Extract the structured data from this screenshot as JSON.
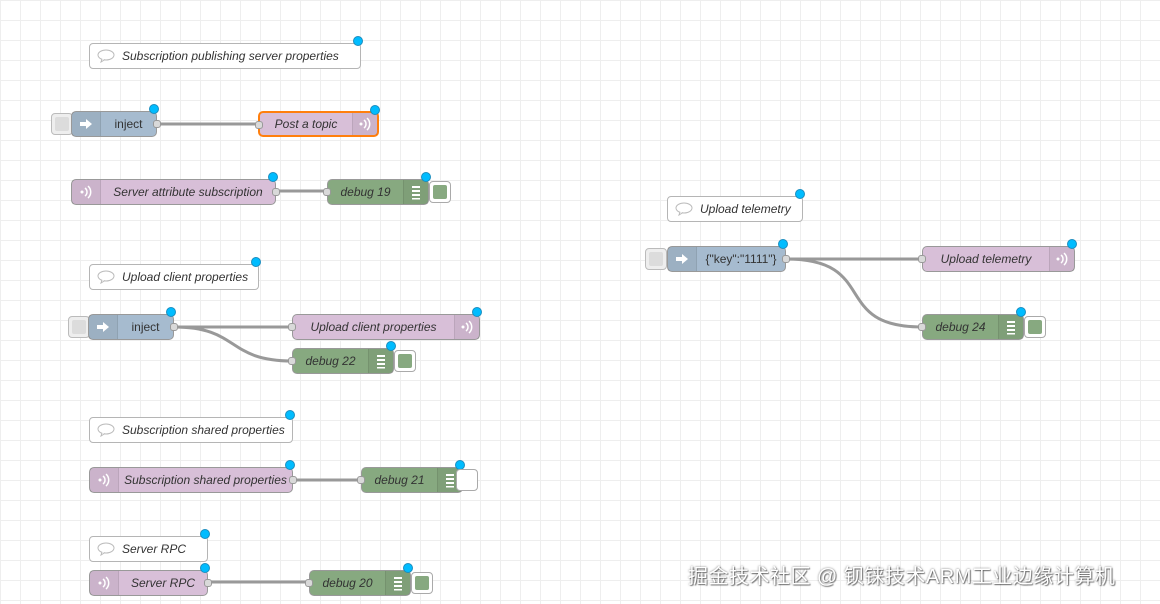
{
  "comments": {
    "c1": "Subscription publishing server properties",
    "c2": "Upload client properties",
    "c3": "Subscription shared properties",
    "c4": "Server RPC",
    "c5": "Upload telemetry"
  },
  "nodes": {
    "inject1": "inject",
    "post_topic": "Post a topic",
    "server_attr_sub": "Server attribute subscription",
    "debug19": "debug 19",
    "inject2": "inject",
    "upload_client_props": "Upload client properties",
    "debug22": "debug 22",
    "shared_props_sub": "Subscription shared properties",
    "debug21": "debug 21",
    "server_rpc": "Server RPC",
    "debug20": "debug 20",
    "inject_telemetry": "{\"key\":\"1111\"}",
    "upload_telemetry": "Upload telemetry",
    "debug24": "debug 24"
  },
  "debug_states": {
    "debug19": "active",
    "debug22": "active",
    "debug21": "inactive",
    "debug20": "active",
    "debug24": "active"
  },
  "colors": {
    "inject": "#a6bbcf",
    "mqtt": "#d8bfd8",
    "debug": "#87a980",
    "selected_border": "#ff7f0e",
    "changed_dot": "#00bcff",
    "wire": "#999999"
  },
  "watermark": "掘金技术社区 @ 钡铼技术ARM工业边缘计算机"
}
